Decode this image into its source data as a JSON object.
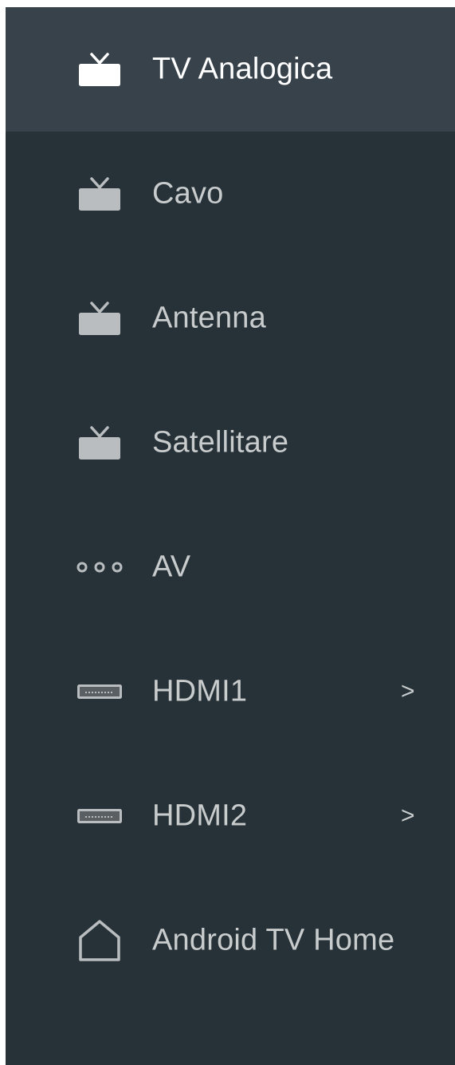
{
  "menu": {
    "items": [
      {
        "label": "TV Analogica",
        "icon": "tv-icon",
        "selected": true,
        "chevron": ""
      },
      {
        "label": "Cavo",
        "icon": "tv-icon",
        "selected": false,
        "chevron": ""
      },
      {
        "label": "Antenna",
        "icon": "tv-icon",
        "selected": false,
        "chevron": ""
      },
      {
        "label": "Satellitare",
        "icon": "tv-icon",
        "selected": false,
        "chevron": ""
      },
      {
        "label": "AV",
        "icon": "av-connector-icon",
        "selected": false,
        "chevron": ""
      },
      {
        "label": "HDMI1",
        "icon": "hdmi-port-icon",
        "selected": false,
        "chevron": ">"
      },
      {
        "label": "HDMI2",
        "icon": "hdmi-port-icon",
        "selected": false,
        "chevron": ">"
      },
      {
        "label": "Android TV Home",
        "icon": "home-icon",
        "selected": false,
        "chevron": ""
      }
    ]
  },
  "colors": {
    "background": "#263238",
    "selected_background": "#37424b",
    "text": "#c9cccd",
    "selected_text": "#ffffff"
  }
}
